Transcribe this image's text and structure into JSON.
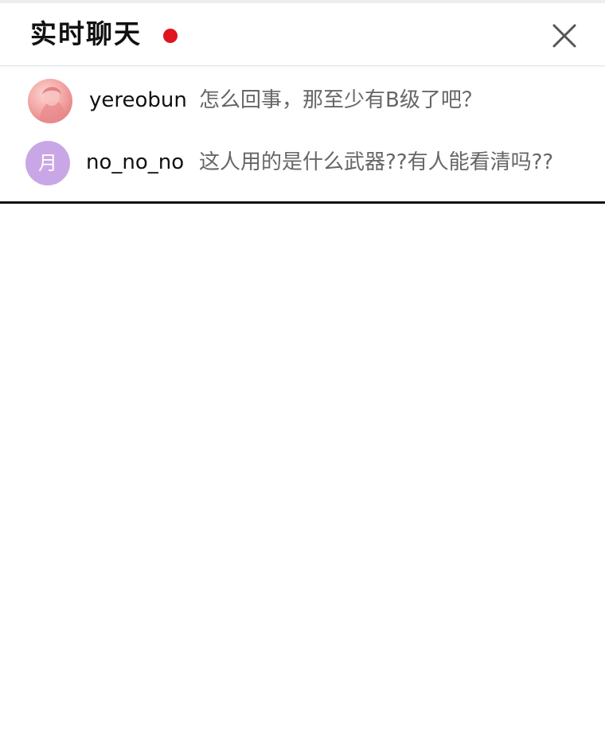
{
  "header": {
    "title": "实时聊天",
    "live_color": "#e0141d",
    "close_icon": "close-icon"
  },
  "chat": {
    "messages": [
      {
        "avatar": {
          "type": "photo",
          "colors": [
            "#fbd5d2",
            "#e57f81"
          ]
        },
        "username": "yereobun",
        "text": "怎么回事，那至少有B级了吧？"
      },
      {
        "avatar": {
          "type": "letter",
          "letter": "月",
          "color": "#c9a7e6"
        },
        "username": "no_no_no",
        "text": "这人用的是什么武器??有人能看清吗??"
      }
    ]
  }
}
